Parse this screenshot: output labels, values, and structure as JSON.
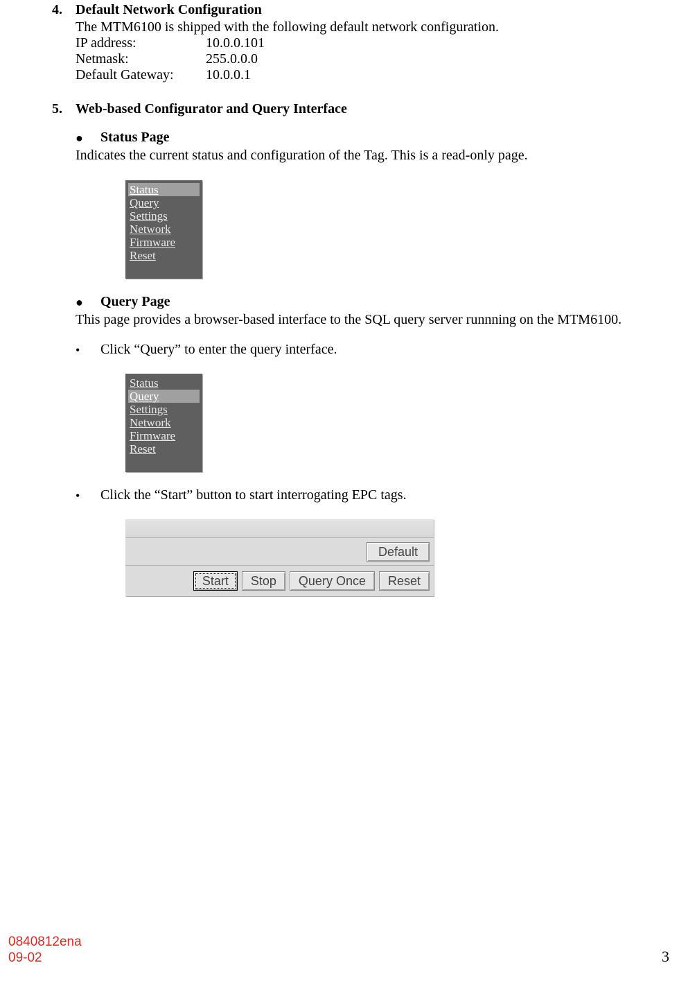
{
  "section4": {
    "num": "4.",
    "title": "Default Network Configuration",
    "intro": "The MTM6100 is shipped with the following default network configuration.",
    "rows": [
      {
        "label": "IP address:",
        "value": "10.0.0.101"
      },
      {
        "label": "Netmask:",
        "value": "255.0.0.0"
      },
      {
        "label": "Default Gateway:",
        "value": "10.0.0.1"
      }
    ]
  },
  "section5": {
    "num": "5.",
    "title": "Web-based Configurator and Query Interface",
    "status": {
      "heading": "Status Page",
      "desc": "Indicates the current status and configuration of the Tag. This is a read-only page."
    },
    "query": {
      "heading": "Query Page",
      "desc": "This page provides a browser-based interface to the SQL query server runnning on the MTM6100.",
      "step1": "Click “Query” to enter the query interface.",
      "step2": "Click the “Start” button to start interrogating EPC tags."
    }
  },
  "menu": {
    "items": [
      "Status",
      "Query",
      "Settings",
      "Network",
      "Firmware",
      "Reset"
    ]
  },
  "buttons": {
    "default": "Default",
    "start": "Start",
    "stop": "Stop",
    "queryOnce": "Query Once",
    "reset": "Reset"
  },
  "footer": {
    "code": "0840812ena",
    "date": "09-02",
    "page": "3"
  }
}
